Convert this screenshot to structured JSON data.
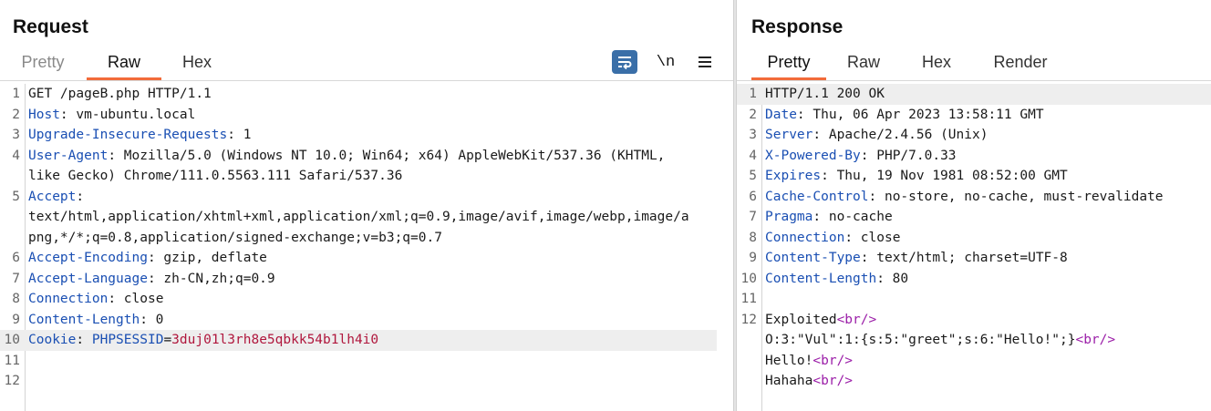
{
  "request": {
    "title": "Request",
    "tabs": [
      "Pretty",
      "Raw",
      "Hex"
    ],
    "active_tab": "Raw",
    "toolbar": {
      "newline_label": "\\n"
    },
    "lines": [
      {
        "n": "1",
        "text": "GET /pageB.php HTTP/1.1"
      },
      {
        "n": "2",
        "key": "Host",
        "val": " vm-ubuntu.local"
      },
      {
        "n": "3",
        "key": "Upgrade-Insecure-Requests",
        "val": " 1"
      },
      {
        "n": "4",
        "key": "User-Agent",
        "val": " Mozilla/5.0 (Windows NT 10.0; Win64; x64) AppleWebKit/537.36 (KHTML,",
        "cont": [
          "like Gecko) Chrome/111.0.5563.111 Safari/537.36"
        ]
      },
      {
        "n": "5",
        "key": "Accept",
        "val": "",
        "cont": [
          "text/html,application/xhtml+xml,application/xml;q=0.9,image/avif,image/webp,image/a",
          "png,*/*;q=0.8,application/signed-exchange;v=b3;q=0.7"
        ]
      },
      {
        "n": "6",
        "key": "Accept-Encoding",
        "val": " gzip, deflate"
      },
      {
        "n": "7",
        "key": "Accept-Language",
        "val": " zh-CN,zh;q=0.9"
      },
      {
        "n": "8",
        "key": "Connection",
        "val": " close"
      },
      {
        "n": "9",
        "key": "Content-Length",
        "val": " 0"
      },
      {
        "n": "10",
        "key": "Cookie",
        "cookie_name": "PHPSESSID",
        "cookie_value": "3duj01l3rh8e5qbkk54b1lh4i0"
      },
      {
        "n": "11"
      },
      {
        "n": "12"
      }
    ]
  },
  "response": {
    "title": "Response",
    "tabs": [
      "Pretty",
      "Raw",
      "Hex",
      "Render"
    ],
    "active_tab": "Pretty",
    "lines": [
      {
        "n": "1",
        "text": "HTTP/1.1 200 OK"
      },
      {
        "n": "2",
        "key": "Date",
        "val": " Thu, 06 Apr 2023 13:58:11 GMT"
      },
      {
        "n": "3",
        "key": "Server",
        "val": " Apache/2.4.56 (Unix)"
      },
      {
        "n": "4",
        "key": "X-Powered-By",
        "val": " PHP/7.0.33"
      },
      {
        "n": "5",
        "key": "Expires",
        "val": " Thu, 19 Nov 1981 08:52:00 GMT"
      },
      {
        "n": "6",
        "key": "Cache-Control",
        "val": " no-store, no-cache, must-revalidate"
      },
      {
        "n": "7",
        "key": "Pragma",
        "val": " no-cache"
      },
      {
        "n": "8",
        "key": "Connection",
        "val": " close"
      },
      {
        "n": "9",
        "key": "Content-Type",
        "val": " text/html; charset=UTF-8"
      },
      {
        "n": "10",
        "key": "Content-Length",
        "val": " 80"
      },
      {
        "n": "11"
      },
      {
        "n": "12",
        "body": [
          [
            [
              "t",
              "Exploited"
            ],
            [
              "g",
              "<br/>"
            ]
          ],
          [
            [
              "t",
              "O:3:\"Vul\":1:{s:5:\"greet\";s:6:\"Hello!\";}"
            ],
            [
              "g",
              "<br/>"
            ]
          ],
          [
            [
              "t",
              "Hello!"
            ],
            [
              "g",
              "<br/>"
            ]
          ],
          [
            [
              "t",
              "Hahaha"
            ],
            [
              "g",
              "<br/>"
            ]
          ]
        ]
      }
    ]
  },
  "colors": {
    "accent": "#f26b3a",
    "header_key": "#1a4fb3",
    "cookie_value": "#b0173d",
    "html_tag": "#9b1ea8",
    "wrap_button": "#3a6fa8"
  },
  "icons": {
    "wrap": "word-wrap-icon",
    "menu": "hamburger-menu-icon"
  }
}
